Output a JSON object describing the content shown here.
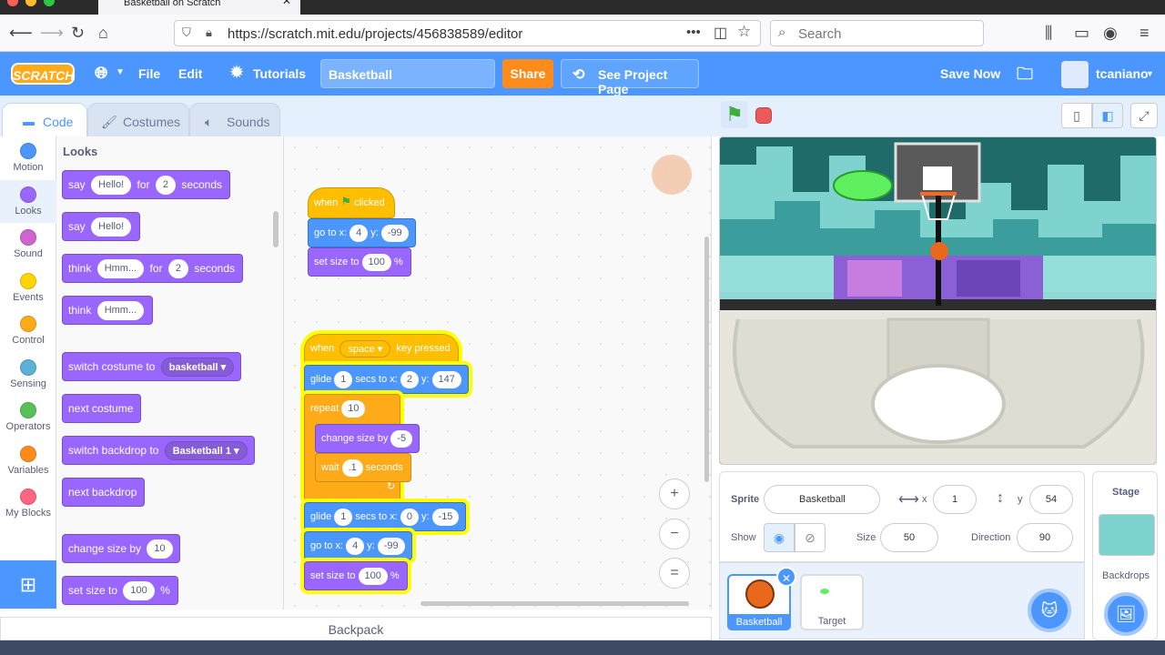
{
  "browser": {
    "tab_title": "Basketball on Scratch",
    "url": "https://scratch.mit.edu/projects/456838589/editor",
    "search_placeholder": "Search"
  },
  "menu": {
    "logo": "SCRATCH",
    "file": "File",
    "edit": "Edit",
    "tutorials": "Tutorials",
    "project_title": "Basketball",
    "share": "Share",
    "see_project_page": "See Project Page",
    "save_now": "Save Now",
    "username": "tcaniano"
  },
  "tabs": {
    "code": "Code",
    "costumes": "Costumes",
    "sounds": "Sounds"
  },
  "categories": [
    {
      "label": "Motion",
      "color": "#4c97ff"
    },
    {
      "label": "Looks",
      "color": "#9966ff"
    },
    {
      "label": "Sound",
      "color": "#cf63cf"
    },
    {
      "label": "Events",
      "color": "#ffd500"
    },
    {
      "label": "Control",
      "color": "#ffab19"
    },
    {
      "label": "Sensing",
      "color": "#5cb1d6"
    },
    {
      "label": "Operators",
      "color": "#59c059"
    },
    {
      "label": "Variables",
      "color": "#ff8c1a"
    },
    {
      "label": "My Blocks",
      "color": "#ff6680"
    }
  ],
  "palette": {
    "heading": "Looks",
    "say_for": {
      "label1": "say",
      "v1": "Hello!",
      "label2": "for",
      "v2": "2",
      "label3": "seconds"
    },
    "say": {
      "label": "say",
      "v": "Hello!"
    },
    "think_for": {
      "label1": "think",
      "v1": "Hmm...",
      "label2": "for",
      "v2": "2",
      "label3": "seconds"
    },
    "think": {
      "label": "think",
      "v": "Hmm..."
    },
    "switch_costume": {
      "label": "switch costume to",
      "v": "basketball"
    },
    "next_costume": "next costume",
    "switch_backdrop": {
      "label": "switch backdrop to",
      "v": "Basketball 1"
    },
    "next_backdrop": "next backdrop",
    "change_size": {
      "label": "change size by",
      "v": "10"
    },
    "set_size": {
      "label": "set size to",
      "v": "100",
      "unit": "%"
    }
  },
  "script1": {
    "when_clicked": {
      "l1": "when",
      "l2": "clicked"
    },
    "goto": {
      "l1": "go to x:",
      "x": "4",
      "l2": "y:",
      "y": "-99"
    },
    "setsize": {
      "l1": "set size to",
      "v": "100",
      "unit": "%"
    }
  },
  "script2": {
    "when_key": {
      "l1": "when",
      "key": "space",
      "l2": "key pressed"
    },
    "glide1": {
      "l1": "glide",
      "secs": "1",
      "l2": "secs to x:",
      "x": "2",
      "l3": "y:",
      "y": "147"
    },
    "repeat": {
      "l1": "repeat",
      "v": "10"
    },
    "change_size": {
      "l1": "change size by",
      "v": "-5"
    },
    "wait": {
      "l1": "wait",
      "v": ".1",
      "l2": "seconds"
    },
    "glide2": {
      "l1": "glide",
      "secs": "1",
      "l2": "secs to x:",
      "x": "0",
      "l3": "y:",
      "y": "-15"
    },
    "goto": {
      "l1": "go to x:",
      "x": "4",
      "l2": "y:",
      "y": "-99"
    },
    "setsize": {
      "l1": "set size to",
      "v": "100",
      "unit": "%"
    }
  },
  "zoom": {
    "in": "+",
    "out": "−",
    "reset": "="
  },
  "backpack": "Backpack",
  "sprite_info": {
    "sprite_label": "Sprite",
    "sprite_name": "Basketball",
    "x_label": "x",
    "x": "1",
    "y_label": "y",
    "y": "54",
    "show_label": "Show",
    "size_label": "Size",
    "size": "50",
    "direction_label": "Direction",
    "direction": "90"
  },
  "sprites": [
    {
      "name": "Basketball"
    },
    {
      "name": "Target"
    }
  ],
  "stage_panel": {
    "title": "Stage",
    "backdrops": "Backdrops"
  }
}
